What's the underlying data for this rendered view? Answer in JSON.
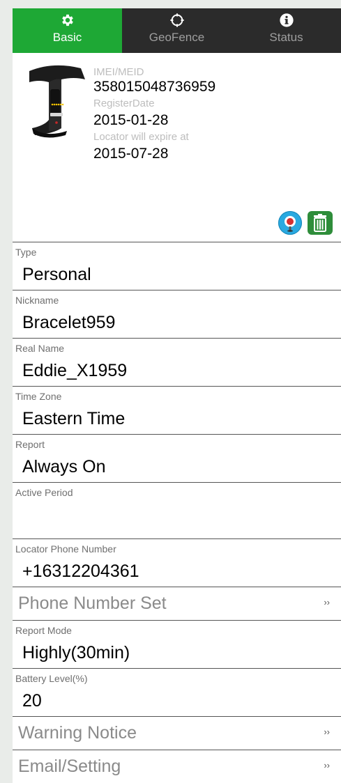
{
  "tabs": [
    {
      "label": "Basic",
      "icon": "gear-icon",
      "active": true
    },
    {
      "label": "GeoFence",
      "icon": "crosshair-icon",
      "active": false
    },
    {
      "label": "Status",
      "icon": "info-icon",
      "active": false
    }
  ],
  "device": {
    "imei_label": "IMEI/MEID",
    "imei_value": "358015048736959",
    "register_label": "RegisterDate",
    "register_value": "2015-01-28",
    "expire_label": "Locator will expire at",
    "expire_value": "2015-07-28",
    "locate_icon": "locate-pin-icon",
    "delete_icon": "trash-icon"
  },
  "fields": {
    "type": {
      "label": "Type",
      "value": "Personal"
    },
    "nickname": {
      "label": "Nickname",
      "value": "Bracelet959"
    },
    "real_name": {
      "label": "Real Name",
      "value": "Eddie_X1959"
    },
    "time_zone": {
      "label": "Time Zone",
      "value": "Eastern Time"
    },
    "report": {
      "label": "Report",
      "value": "Always On"
    },
    "active_period": {
      "label": "Active Period",
      "value": ""
    },
    "locator_phone": {
      "label": "Locator Phone Number",
      "value": "+16312204361"
    },
    "report_mode": {
      "label": "Report Mode",
      "value": "Highly(30min)"
    },
    "battery": {
      "label": "Battery Level(%)",
      "value": "20"
    }
  },
  "links": {
    "phone_number_set": "Phone Number Set",
    "warning_notice": "Warning Notice",
    "email_setting": "Email/Setting",
    "chevron": "››"
  },
  "colors": {
    "accent": "#1ea835",
    "tabbar": "#2b2b2b",
    "locate_button": "#29a9e0",
    "delete_button": "#2e8d3a"
  }
}
